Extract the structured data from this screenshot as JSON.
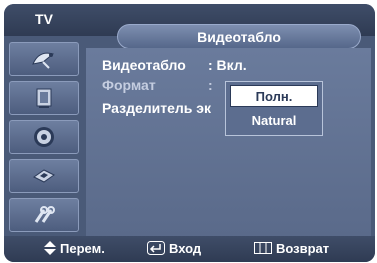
{
  "header": {
    "tv_label": "TV",
    "title": "Видеотабло"
  },
  "sidebar": {
    "items": [
      {
        "icon": "satellite-dish-icon"
      },
      {
        "icon": "display-frame-icon"
      },
      {
        "icon": "speaker-icon"
      },
      {
        "icon": "chip-icon"
      },
      {
        "icon": "tools-icon"
      }
    ]
  },
  "menu": {
    "items": [
      {
        "label": "Видеотабло",
        "value": ": Вкл."
      },
      {
        "label": "Формат",
        "value": ":"
      },
      {
        "label": "Разделитель эк",
        "value": ""
      }
    ]
  },
  "dropdown": {
    "options": [
      {
        "label": "Полн.",
        "selected": true
      },
      {
        "label": "Natural",
        "selected": false
      }
    ]
  },
  "footer": {
    "move": {
      "icon": "up-down-arrows-icon",
      "label": "Перем."
    },
    "enter": {
      "icon": "enter-icon",
      "label": "Вход"
    },
    "return": {
      "icon": "return-icon",
      "label": "Возврат"
    }
  },
  "colors": {
    "menu_text_active": "#ffffff",
    "menu_text_inactive": "#c4cde0",
    "accent": "#5c6d8f"
  }
}
